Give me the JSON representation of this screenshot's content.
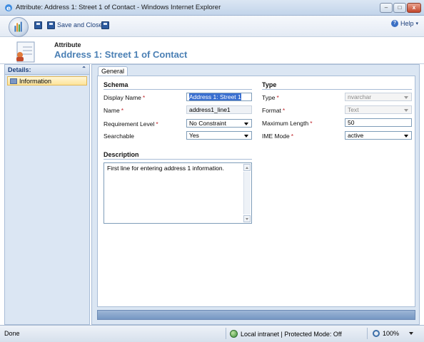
{
  "window": {
    "title": "Attribute: Address 1: Street 1 of Contact - Windows Internet Explorer",
    "minimize": "–",
    "restore": "□",
    "close": "x"
  },
  "toolbar": {
    "save_and_close_label": "Save and Close",
    "help_label": "Help"
  },
  "header": {
    "label": "Attribute",
    "name": "Address 1: Street 1 of Contact"
  },
  "leftnav": {
    "title": "Details:",
    "items": [
      {
        "label": "Information"
      }
    ]
  },
  "tabs": [
    {
      "label": "General"
    }
  ],
  "schema": {
    "title": "Schema",
    "display_name_label": "Display Name",
    "display_name_value": "Address 1: Street 1",
    "name_label": "Name",
    "name_value": "address1_line1",
    "requirement_label": "Requirement Level",
    "requirement_value": "No Constraint",
    "searchable_label": "Searchable",
    "searchable_value": "Yes"
  },
  "type": {
    "title": "Type",
    "type_label": "Type",
    "type_value": "nvarchar",
    "format_label": "Format",
    "format_value": "Text",
    "max_length_label": "Maximum Length",
    "max_length_value": "50",
    "ime_label": "IME Mode",
    "ime_value": "active"
  },
  "description": {
    "title": "Description",
    "text": "First line for entering address 1 information."
  },
  "status": {
    "left": "Done",
    "zone": "Local intranet | Protected Mode: Off",
    "zoom": "100%"
  },
  "required_marker": "*",
  "colors": {
    "header_name": "#4a7fb4",
    "required": "#c0272d",
    "nav_selected": "#fde49a"
  }
}
